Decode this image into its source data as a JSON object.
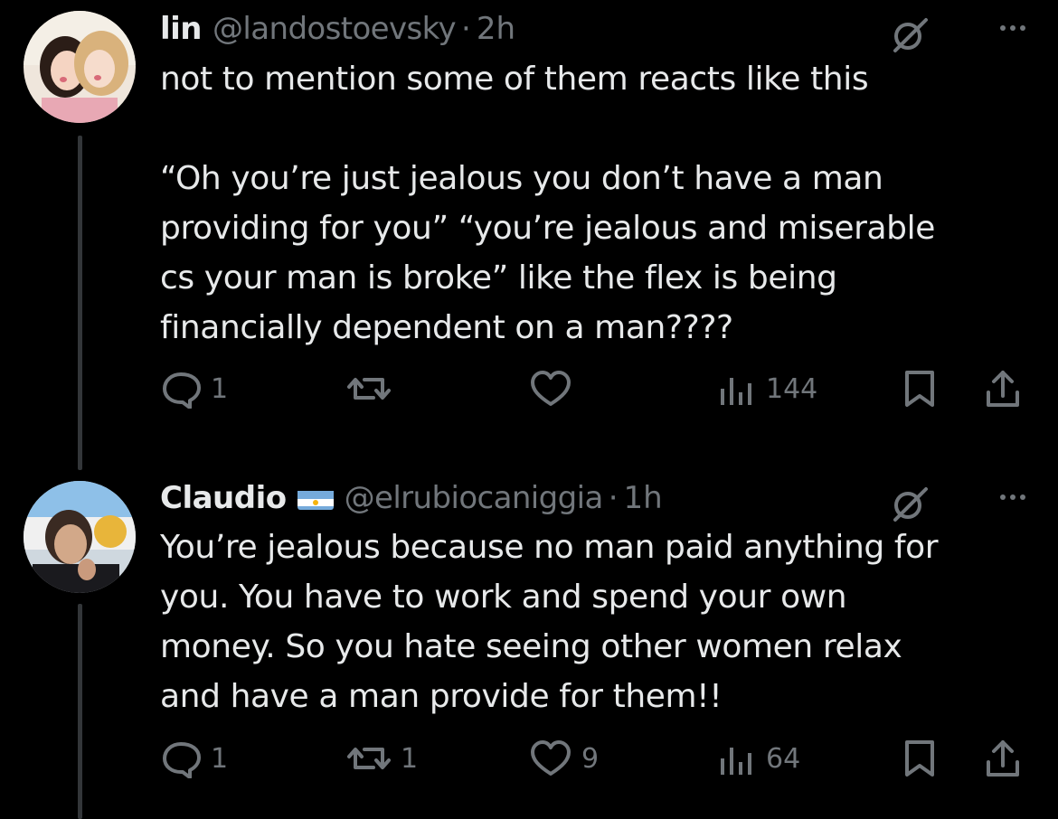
{
  "tweets": [
    {
      "name": "lin",
      "handle": "@landostoevsky",
      "separator": "·",
      "time": "2h",
      "body_lines": [
        "not to mention some of them reacts like this",
        "",
        "“Oh you’re just jealous you don’t have a man",
        "providing for you” “you’re jealous and miserable",
        "cs your man is broke” like the flex is being",
        "financially dependent on a man????"
      ],
      "replies": "1",
      "reposts": "",
      "likes": "",
      "views": "144"
    },
    {
      "name": "Claudio",
      "flag": "argentina-flag",
      "handle": "@elrubiocaniggia",
      "separator": "·",
      "time": "1h",
      "body_lines": [
        "You’re jealous because no man paid anything for",
        "you. You have to work and spend your own",
        "money. So you hate seeing other women relax",
        "and have a man provide for them!!"
      ],
      "replies": "1",
      "reposts": "1",
      "likes": "9",
      "views": "64"
    }
  ],
  "icons": {
    "reply": "speech-bubble-icon",
    "repost": "repost-arrows-icon",
    "like": "heart-icon",
    "views": "bar-chart-icon",
    "bookmark": "bookmark-icon",
    "share": "share-upload-icon",
    "grok": "grok-slash-icon",
    "more": "more-dots-icon"
  },
  "colors": {
    "background": "#000000",
    "text": "#e7e9ea",
    "secondary": "#71767b",
    "thread_line": "#333639"
  }
}
